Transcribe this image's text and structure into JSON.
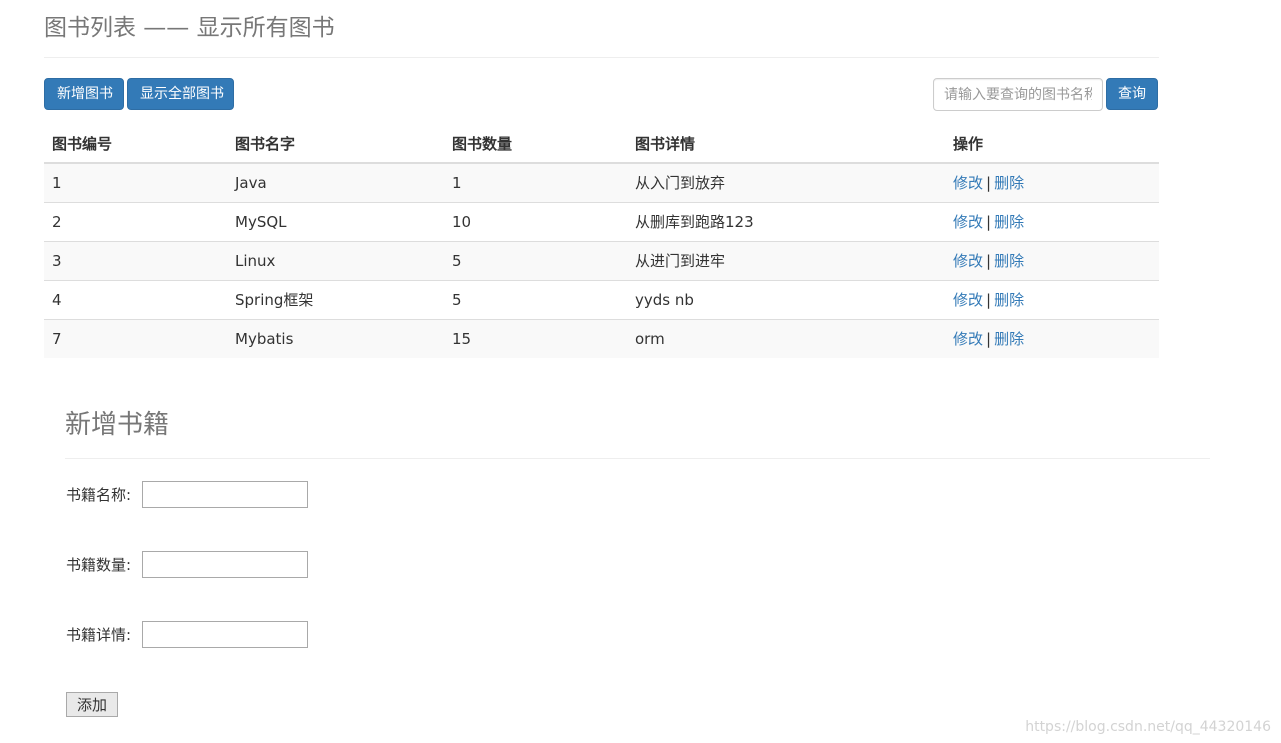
{
  "page": {
    "title": "图书列表 —— 显示所有图书"
  },
  "toolbar": {
    "add_label": "新增图书",
    "show_all_label": "显示全部图书",
    "search_placeholder": "请输入要查询的图书名称",
    "search_value": "",
    "query_label": "查询"
  },
  "table": {
    "headers": [
      "图书编号",
      "图书名字",
      "图书数量",
      "图书详情",
      "操作"
    ],
    "rows": [
      {
        "id": "1",
        "name": "Java",
        "count": "1",
        "detail": "从入门到放弃"
      },
      {
        "id": "2",
        "name": "MySQL",
        "count": "10",
        "detail": "从删库到跑路123"
      },
      {
        "id": "3",
        "name": "Linux",
        "count": "5",
        "detail": "从进门到进牢"
      },
      {
        "id": "4",
        "name": "Spring框架",
        "count": "5",
        "detail": "yyds nb"
      },
      {
        "id": "7",
        "name": "Mybatis",
        "count": "15",
        "detail": "orm"
      }
    ],
    "edit_label": "修改",
    "separator": "|",
    "delete_label": "删除"
  },
  "form": {
    "title": "新增书籍",
    "name_label": "书籍名称:",
    "name_value": "",
    "count_label": "书籍数量:",
    "count_value": "",
    "detail_label": "书籍详情:",
    "detail_value": "",
    "submit_label": "添加"
  },
  "watermark": "https://blog.csdn.net/qq_44320146",
  "colors": {
    "primary": "#337ab7",
    "header_text": "#777777",
    "stripe": "#f9f9f9"
  }
}
